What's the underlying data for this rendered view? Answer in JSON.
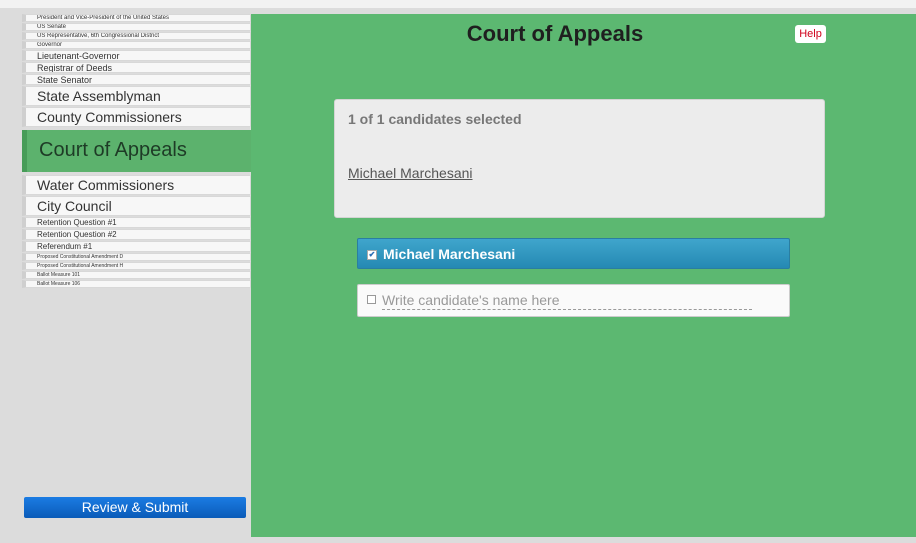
{
  "sidebar": {
    "items": [
      {
        "label": "President and Vice-President of the United States"
      },
      {
        "label": "US Senate"
      },
      {
        "label": "US Representative, 6th Congressional District"
      },
      {
        "label": "Governor"
      },
      {
        "label": "Lieutenant-Governor"
      },
      {
        "label": "Registrar of Deeds"
      },
      {
        "label": "State Senator"
      },
      {
        "label": "State Assemblyman"
      },
      {
        "label": "County Commissioners"
      },
      {
        "label": "Court of Appeals"
      },
      {
        "label": "Water Commissioners"
      },
      {
        "label": "City Council"
      },
      {
        "label": "Retention Question #1"
      },
      {
        "label": "Retention Question #2"
      },
      {
        "label": "Referendum #1"
      },
      {
        "label": "Proposed Constitutional Amendment D"
      },
      {
        "label": "Proposed Constitutional Amendment H"
      },
      {
        "label": "Ballot Measure 101"
      },
      {
        "label": "Ballot Measure 106"
      }
    ],
    "active_index": 9,
    "review_label": "Review & Submit"
  },
  "main": {
    "title": "Court of Appeals",
    "help_label": "Help",
    "selection_count": "1 of 1 candidates selected",
    "selected_name": "Michael Marchesani",
    "candidate": {
      "name": "Michael Marchesani",
      "checked": true
    },
    "writein_placeholder": "Write candidate's name here"
  },
  "colors": {
    "panel_green": "#5cb871",
    "candidate_blue": "#2f97c0",
    "review_blue": "#0f66c9",
    "help_red": "#d0021b"
  }
}
